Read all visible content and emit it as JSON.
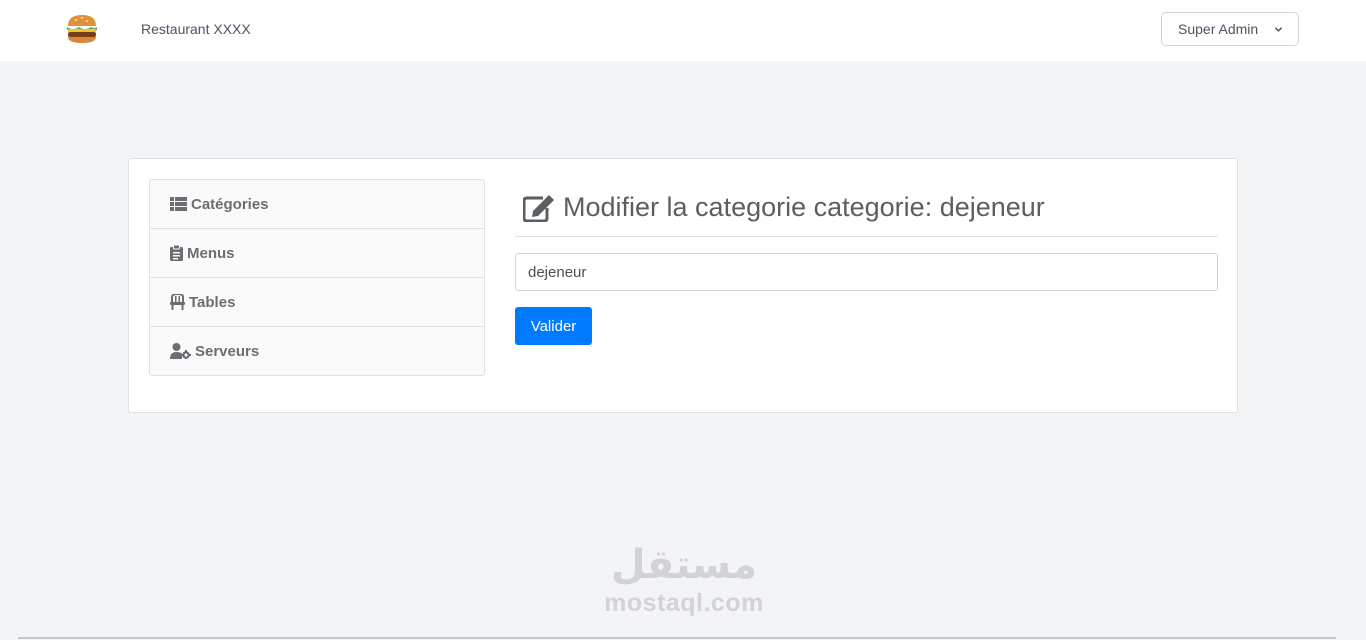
{
  "navbar": {
    "logo_icon": "burger-icon",
    "brand": "Restaurant XXXX",
    "user_menu_label": "Super Admin"
  },
  "sidebar": {
    "items": [
      {
        "label": "Catégories",
        "icon": "th-list-icon"
      },
      {
        "label": "Menus",
        "icon": "clipboard-icon"
      },
      {
        "label": "Tables",
        "icon": "chair-icon"
      },
      {
        "label": "Serveurs",
        "icon": "user-cog-icon"
      }
    ]
  },
  "form": {
    "title_icon": "edit-icon",
    "title": "Modifier la categorie categorie: dejeneur",
    "name_value": "dejeneur",
    "submit_label": "Valider"
  },
  "watermark": {
    "arabic": "مستقل",
    "latin": "mostaql.com"
  },
  "colors": {
    "primary": "#007bff",
    "page_bg": "#f3f4f6"
  }
}
